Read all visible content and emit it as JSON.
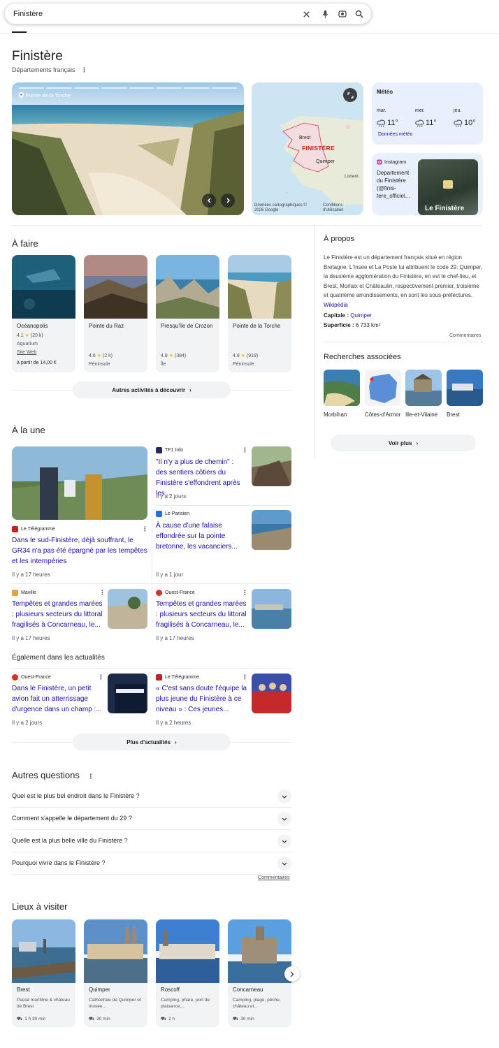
{
  "search": {
    "query": "Finistère"
  },
  "entity": {
    "title": "Finistère",
    "subtitle": "Départements français"
  },
  "hero": {
    "label": "Pointe de la Torche"
  },
  "map": {
    "labels": [
      "Brest",
      "FINISTÈRE",
      "Quimper",
      "Lorient"
    ],
    "credits": "Données cartographiques © 2026 Google",
    "terms": "Conditions d'utilisation"
  },
  "meteo": {
    "title": "Météo",
    "days": [
      {
        "day": "mar.",
        "temp": "11°"
      },
      {
        "day": "mer.",
        "temp": "11°"
      },
      {
        "day": "jeu.",
        "temp": "10°"
      }
    ],
    "source": "Données météo"
  },
  "instagram": {
    "label": "Instagram",
    "text": "Departement du Finistère (@finis-tere_officiel...",
    "image_caption": "Le Finistère"
  },
  "a_faire": {
    "title": "À faire",
    "cards": [
      {
        "name": "Océanopolis",
        "rating": "4.1",
        "reviews": "(20 k)",
        "category": "Aquarium",
        "link": "Site Web",
        "price": "à partir de 14,00 €"
      },
      {
        "name": "Pointe du Raz",
        "rating": "4.6",
        "reviews": "(2 k)",
        "category": "Péninsule"
      },
      {
        "name": "Presqu'île de Crozon",
        "rating": "4.8",
        "reviews": "(384)",
        "category": "Île"
      },
      {
        "name": "Pointe de la Torche",
        "rating": "4.8",
        "reviews": "(919)",
        "category": "Péninsule"
      }
    ],
    "more": "Autres activités à découvrir"
  },
  "about": {
    "title": "À propos",
    "text": "Le Finistère est un département français situé en région Bretagne. L'Insee et La Poste lui attribuent le code 29. Quimper, la deuxième agglomération du Finistère, en est le chef-lieu, et Brest, Morlaix et Châteaulin, respectivement premier, troisième et quatrième arrondissements, en sont les sous-préfectures.",
    "source": "Wikipédia",
    "capital_label": "Capitale :",
    "capital": "Quimper",
    "area_label": "Superficie :",
    "area": "6 733 km²",
    "feedback": "Commentaires"
  },
  "related": {
    "title": "Recherches associées",
    "items": [
      "Morbihan",
      "Côtes-d'Armor",
      "Ille-et-Vilaine",
      "Brest"
    ],
    "more": "Voir plus"
  },
  "news": {
    "title": "À la une",
    "main": {
      "source": "Le Télégramme",
      "headline": "Dans le sud-Finistère, déjà souffrant, le GR34 n'a pas été épargné par les tempêtes et les intempéries",
      "time": "Il y a 17 heures"
    },
    "side": [
      {
        "source": "TF1 Info",
        "headline": "\"Il n'y a plus de chemin\" : des sentiers côtiers du Finistère s'effondrent après les...",
        "time": "Il y a 2 jours"
      },
      {
        "source": "Le Parisien",
        "headline": "À cause d'une falaise effondrée sur la pointe bretonne, les vacanciers...",
        "time": "Il y a 1 jour"
      }
    ],
    "row": [
      {
        "source": "Maville",
        "headline": "Tempêtes et grandes marées : plusieurs secteurs du littoral fragilisés à Concarneau, le...",
        "time": "Il y a 17 heures"
      },
      {
        "source": "Ouest-France",
        "headline": "Tempêtes et grandes marées : plusieurs secteurs du littoral fragilisés à Concarneau, le...",
        "time": "Il y a 17 heures"
      }
    ],
    "also_title": "Également dans les actualités",
    "also": [
      {
        "source": "Ouest-France",
        "headline": "Dans le Finistère, un petit avion fait un atterrissage d'urgence dans un champ :...",
        "time": "Il y a 2 jours"
      },
      {
        "source": "Le Télégramme",
        "headline": "« C'est sans doute l'équipe la plus jeune du Finistère à ce niveau » : Ces jeunes...",
        "time": "Il y a 2 heures"
      }
    ],
    "more": "Plus d'actualités"
  },
  "faq": {
    "title": "Autres questions",
    "items": [
      "Quel est le plus bel endroit dans le Finistère ?",
      "Comment s'appelle le département du 29 ?",
      "Quelle est la plus belle ville du Finistère ?",
      "Pourquoi vivre dans le Finistère ?"
    ],
    "feedback": "Commentaires"
  },
  "places": {
    "title": "Lieux à visiter",
    "items": [
      {
        "name": "Brest",
        "desc": "Passé maritime & château de Brest",
        "time": "1 h 30 min"
      },
      {
        "name": "Quimper",
        "desc": "Cathédrale de Quimper et musée...",
        "time": "30 min"
      },
      {
        "name": "Roscoff",
        "desc": "Camping, phare, port de plaisance,...",
        "time": "2 h"
      },
      {
        "name": "Concarneau",
        "desc": "Camping, plage, pêche, château et...",
        "time": "30 min"
      }
    ]
  },
  "colors": {
    "link": "#1a0dab",
    "text": "#1f1f1f",
    "muted": "#4d5156",
    "chip": "#f1f3f4",
    "weather_bg": "#e8f0fe"
  }
}
